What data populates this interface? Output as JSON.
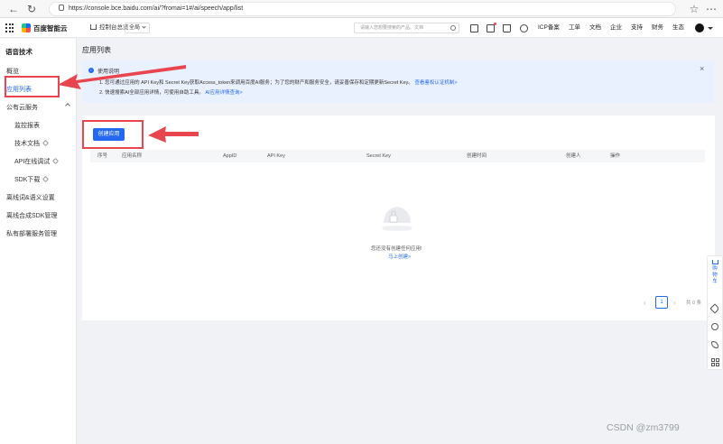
{
  "browser": {
    "url": "https://console.bce.baidu.com/ai/?fromai=1#/ai/speech/app/list"
  },
  "header": {
    "brand": "百度智能云",
    "home": "控制台总览",
    "region": "全局",
    "search_placeholder": "请输入您想要搜索的产品、文档",
    "nav": [
      "ICP备案",
      "工单",
      "文档",
      "企业",
      "支持",
      "财务",
      "生态"
    ]
  },
  "sidebar": {
    "title": "语音技术",
    "items": [
      {
        "label": "概览"
      },
      {
        "label": "应用列表",
        "active": true
      },
      {
        "label": "公有云服务",
        "expandable": true
      },
      {
        "label": "监控报表",
        "sub": true
      },
      {
        "label": "技术文档",
        "sub": true,
        "link": true
      },
      {
        "label": "API在线调试",
        "sub": true,
        "link": true
      },
      {
        "label": "SDK下载",
        "sub": true,
        "link": true
      },
      {
        "label": "离线词&语义设置"
      },
      {
        "label": "离线合成SDK管理"
      },
      {
        "label": "私有部署服务管理"
      }
    ]
  },
  "main": {
    "title": "应用列表",
    "notice": {
      "title": "使用说明",
      "line1": "1. 您可通过应用的 API Key和 Secret Key获取Access_token来调用百度AI服务；为了您的财产和服务安全，请妥善保存和定期更新Secret Key。",
      "line1_link": "查看鉴权认证机制>",
      "line2": "2. 快速搜索AI全部应用详情，可使用自助工具。",
      "line2_link": "AI应用详情查询>"
    },
    "create_button": "创建应用",
    "columns": [
      "序号",
      "应用名称",
      "AppID",
      "API Key",
      "Secret Key",
      "创建时间",
      "创建人",
      "操作"
    ],
    "empty_text": "您还没有创建任何应用!",
    "empty_link": "马上创建>",
    "pagination": {
      "page": "1",
      "total": "共 0 条"
    }
  },
  "float_bar": {
    "cart": "购物车"
  },
  "watermark": "CSDN @zm3799",
  "colors": {
    "accent": "#2468f2",
    "annotation": "#e8454f",
    "notice_bg": "#eaf1fe"
  }
}
